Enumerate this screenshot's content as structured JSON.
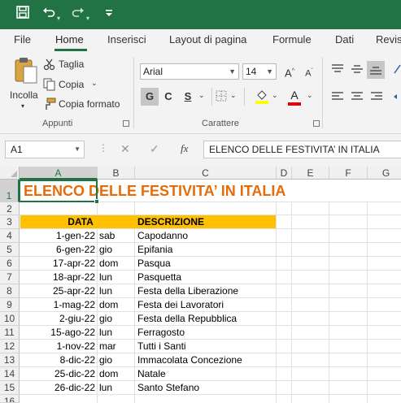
{
  "quick_access": {
    "save_icon": "save-icon",
    "undo_icon": "undo-icon",
    "redo_icon": "redo-icon",
    "customize_icon": "customize-icon"
  },
  "tabs": [
    "File",
    "Home",
    "Inserisci",
    "Layout di pagina",
    "Formule",
    "Dati",
    "Revis"
  ],
  "active_tab": "Home",
  "clipboard": {
    "paste_label": "Incolla",
    "cut_label": "Taglia",
    "copy_label": "Copia",
    "format_painter_label": "Copia formato",
    "group_label": "Appunti"
  },
  "font": {
    "font_name": "Arial",
    "font_size": "14",
    "bold": "G",
    "italic": "C",
    "underline": "S",
    "group_label": "Carattere",
    "fill_color": "#ffff00",
    "font_color": "#e00000"
  },
  "formula_bar": {
    "name_box": "A1",
    "fx": "fx",
    "content": "ELENCO DELLE FESTIVITA’ IN ITALIA"
  },
  "columns": [
    "A",
    "B",
    "C",
    "D",
    "E",
    "F",
    "G"
  ],
  "rows": [
    "1",
    "2",
    "3",
    "4",
    "5",
    "6",
    "7",
    "8",
    "9",
    "10",
    "11",
    "12",
    "13",
    "14",
    "15",
    "16"
  ],
  "sheet": {
    "title": "ELENCO DELLE FESTIVITA’ IN ITALIA",
    "title_color": "#e46c0a",
    "header_fill": "#ffc000",
    "header_data": "DATA",
    "header_descrizione": "DESCRIZIONE",
    "entries": [
      {
        "date": "1-gen-22",
        "day": "sab",
        "desc": "Capodanno"
      },
      {
        "date": "6-gen-22",
        "day": "gio",
        "desc": "Epifania"
      },
      {
        "date": "17-apr-22",
        "day": "dom",
        "desc": "Pasqua"
      },
      {
        "date": "18-apr-22",
        "day": "lun",
        "desc": "Pasquetta"
      },
      {
        "date": "25-apr-22",
        "day": "lun",
        "desc": "Festa della Liberazione"
      },
      {
        "date": "1-mag-22",
        "day": "dom",
        "desc": "Festa dei Lavoratori"
      },
      {
        "date": "2-giu-22",
        "day": "gio",
        "desc": "Festa della Repubblica"
      },
      {
        "date": "15-ago-22",
        "day": "lun",
        "desc": "Ferragosto"
      },
      {
        "date": "1-nov-22",
        "day": "mar",
        "desc": "Tutti i Santi"
      },
      {
        "date": "8-dic-22",
        "day": "gio",
        "desc": "Immacolata Concezione"
      },
      {
        "date": "25-dic-22",
        "day": "dom",
        "desc": "Natale"
      },
      {
        "date": "26-dic-22",
        "day": "lun",
        "desc": "Santo Stefano"
      }
    ]
  }
}
